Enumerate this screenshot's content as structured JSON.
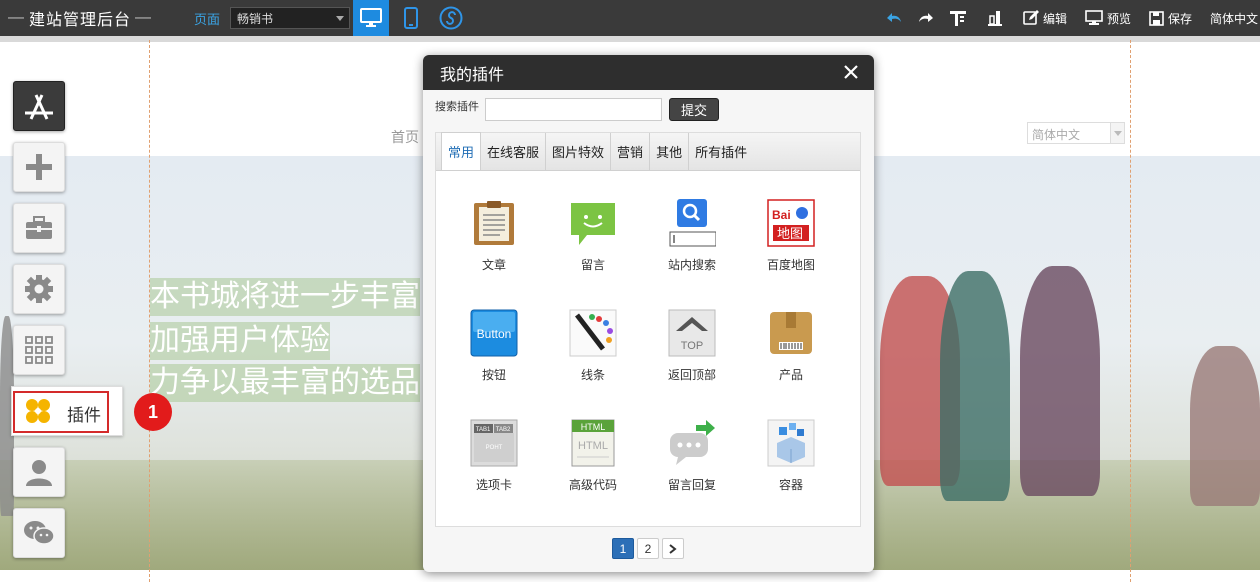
{
  "topbar": {
    "brand": "建站管理后台",
    "page_label": "页面",
    "page_select": "畅销书",
    "tools": {
      "undo": "undo-icon",
      "redo": "redo-icon",
      "edit": "编辑",
      "preview": "预览",
      "save": "保存",
      "lang": "简体中文"
    }
  },
  "site": {
    "nav_home": "首页",
    "lang_select": "简体中文",
    "banner_lines": [
      "本书城将进一步丰富",
      "加强用户体验",
      "力争以最丰富的选品"
    ]
  },
  "sidebar": {
    "plugin_label": "插件",
    "step_number": "1"
  },
  "dialog": {
    "title": "我的插件",
    "search_label": "搜索插件",
    "search_value": "",
    "submit": "提交",
    "tabs": [
      "常用",
      "在线客服",
      "图片特效",
      "营销",
      "其他",
      "所有插件"
    ],
    "active_tab": "常用",
    "items": [
      {
        "label": "文章",
        "icon": "article-icon"
      },
      {
        "label": "留言",
        "icon": "message-icon"
      },
      {
        "label": "站内搜索",
        "icon": "site-search-icon"
      },
      {
        "label": "百度地图",
        "icon": "baidu-map-icon"
      },
      {
        "label": "按钮",
        "icon": "button-icon"
      },
      {
        "label": "线条",
        "icon": "line-icon"
      },
      {
        "label": "返回顶部",
        "icon": "back-to-top-icon"
      },
      {
        "label": "产品",
        "icon": "product-icon"
      },
      {
        "label": "选项卡",
        "icon": "tabs-icon"
      },
      {
        "label": "高级代码",
        "icon": "html-code-icon"
      },
      {
        "label": "留言回复",
        "icon": "reply-icon"
      },
      {
        "label": "容器",
        "icon": "container-icon"
      }
    ],
    "icon_texts": {
      "button": "Button",
      "top": "TOP",
      "html": "HTML",
      "baidu_top": "Bai",
      "baidu_bottom": "地图",
      "tab1": "TAB1",
      "tab2": "TAB2",
      "tab_content": "POHT"
    },
    "pages": [
      "1",
      "2"
    ],
    "next": "›"
  }
}
